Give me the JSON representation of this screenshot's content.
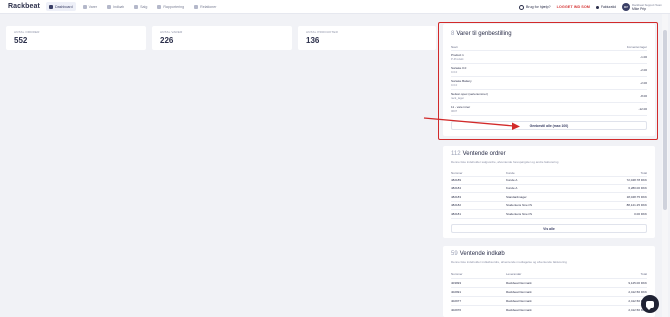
{
  "app": {
    "logo": "Rackbeat"
  },
  "nav": [
    {
      "label": "Dashboard",
      "icon": "send-icon",
      "active": true
    },
    {
      "label": "Varer",
      "icon": "box-icon"
    },
    {
      "label": "Indkøb",
      "icon": "cart-icon"
    },
    {
      "label": "Salg",
      "icon": "tag-icon"
    },
    {
      "label": "Rapportering",
      "icon": "chart-icon"
    },
    {
      "label": "Relationer",
      "icon": "people-icon"
    }
  ],
  "header": {
    "help": "Brug for hjælp?",
    "logged_in": "LOGGET IND SOM",
    "cart": "Fakturatid",
    "avatar": "MP",
    "company": "Rackbeat Support Team",
    "user": "Mike Prip"
  },
  "stats": [
    {
      "label": "ANTAL ORDRER",
      "value": "552"
    },
    {
      "label": "ANTAL VARER",
      "value": "226"
    },
    {
      "label": "ANTAL PRODUKTER",
      "value": "136"
    }
  ],
  "reorder": {
    "count": "8",
    "title": "Varer til genbestilling",
    "col_name": "Navn",
    "col_qty": "Forventet lager",
    "rows": [
      {
        "name": "Product 1",
        "sku": "P-Produkt",
        "qty": "-1.00"
      },
      {
        "name": "Sorteke 0.0",
        "sku": "0.0.0",
        "qty": "-2.00"
      },
      {
        "name": "Sorteke Battery",
        "sku": "0.0.0",
        "qty": "-2.00"
      },
      {
        "name": "Nelson spec (serienummer)",
        "sku": "rack_lager",
        "qty": "-8.00"
      },
      {
        "name": "11 - vare inner",
        "sku": "0007",
        "qty": "-12.00"
      }
    ],
    "button": "Genbestil alle (max 100)"
  },
  "pending_orders": {
    "count": "112",
    "title": "Ventende ordrer",
    "subtitle": "Denne liste indeholder salgsordre, afventende forespørgsler og andre fakturering",
    "col_number": "Nummer",
    "col_customer": "Kunde",
    "col_total": "Total",
    "rows": [
      {
        "number": "482189",
        "customer": "Kunde A",
        "total": "72,048.78 DKK"
      },
      {
        "number": "482184",
        "customer": "Kunde A",
        "total": "6,280.00 DKK"
      },
      {
        "number": "482183",
        "customer": "Standardmager",
        "total": "18,048.75 DKK"
      },
      {
        "number": "482182",
        "customer": "Studentens hine i/S",
        "total": "88,121.25 DKK"
      },
      {
        "number": "482181",
        "customer": "Studentens hine i/S",
        "total": "0.00 DKK"
      }
    ],
    "button": "Vis alle"
  },
  "pending_purchases": {
    "count": "59",
    "title": "Ventende indkøb",
    "subtitle": "Denne liste indeholder indkøbsordre, afventende modtagelse og afventende fakturering",
    "col_number": "Nummer",
    "col_supplier": "Leverandør",
    "col_total": "Total",
    "rows": [
      {
        "number": "403993",
        "supplier": "Rackbeat Denmark",
        "total": "9,125.00 DKK"
      },
      {
        "number": "402991",
        "supplier": "Rackbeat Denmark",
        "total": "2,412.50 DKK"
      },
      {
        "number": "402977",
        "supplier": "Rackbeat Denmark",
        "total": "2,412.50 DKK"
      },
      {
        "number": "402976",
        "supplier": "Rackbeat Denmark",
        "total": "2,412.50 DKK"
      }
    ]
  }
}
